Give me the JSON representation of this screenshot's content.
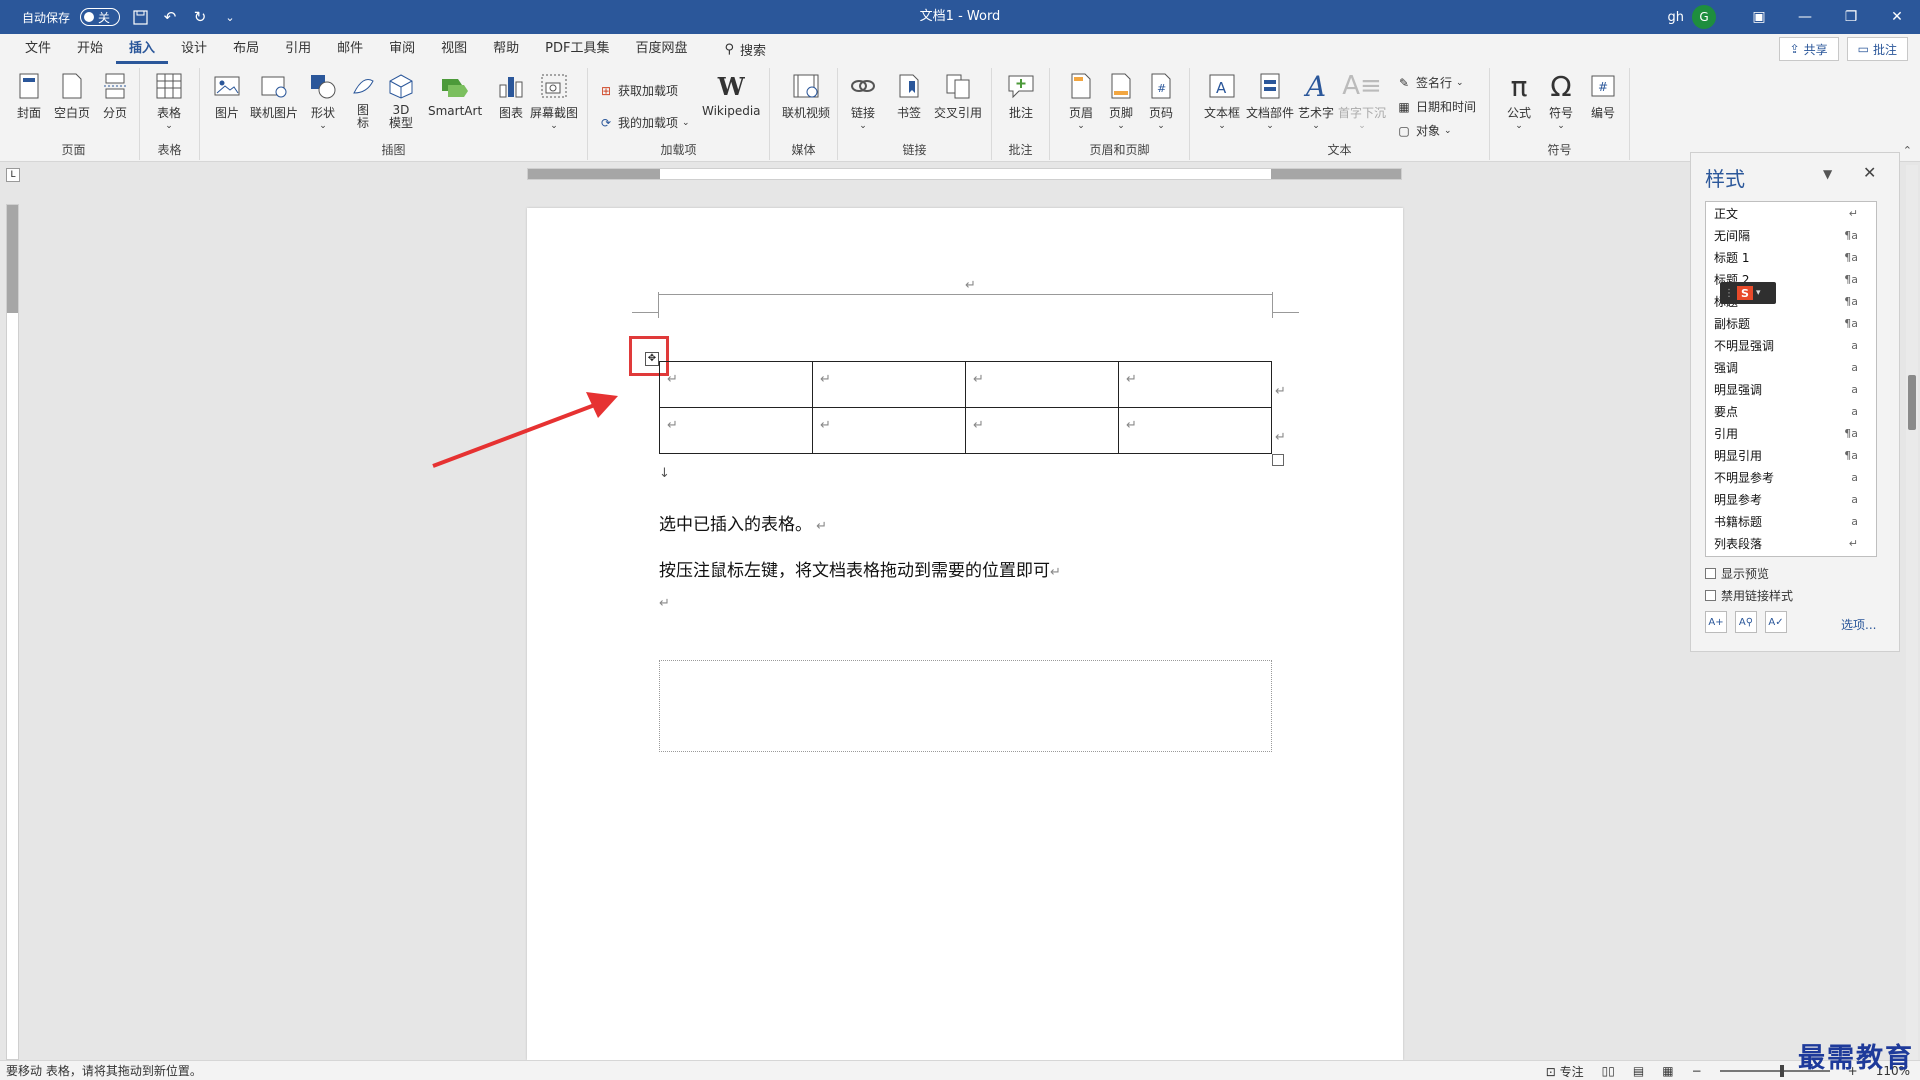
{
  "titlebar": {
    "autosave_label": "自动保存",
    "autosave_state": "关",
    "title": "文档1  -  Word",
    "user": "gh",
    "avatar_letter": "G"
  },
  "tabs": [
    "文件",
    "开始",
    "插入",
    "设计",
    "布局",
    "引用",
    "邮件",
    "审阅",
    "视图",
    "帮助",
    "PDF工具集",
    "百度网盘"
  ],
  "active_tab": "插入",
  "search_label": "搜索",
  "share_label": "共享",
  "comments_label": "批注",
  "ribbon": {
    "groups": {
      "pages": "页面",
      "tables": "表格",
      "illustrations": "插图",
      "addins": "加载项",
      "media": "媒体",
      "links": "链接",
      "comments": "批注",
      "header_footer": "页眉和页脚",
      "text": "文本",
      "symbols": "符号"
    },
    "buttons": {
      "cover": "封面",
      "blank_page": "空白页",
      "page_break": "分页",
      "table": "表格",
      "picture": "图片",
      "online_picture": "联机图片",
      "shapes": "形状",
      "icons": "图\n标",
      "model3d": "3D\n模型",
      "smartart": "SmartArt",
      "chart": "图表",
      "screenshot": "屏幕截图",
      "get_addins": "获取加载项",
      "my_addins": "我的加载项",
      "wikipedia": "Wikipedia",
      "online_video": "联机视频",
      "link": "链接",
      "bookmark": "书签",
      "cross_ref": "交叉引用",
      "comment": "批注",
      "header": "页眉",
      "footer": "页脚",
      "page_number": "页码",
      "textbox": "文本框",
      "quick_parts": "文档部件",
      "wordart": "艺术字",
      "dropcap": "首字下沉",
      "signature": "签名行",
      "datetime": "日期和时间",
      "object": "对象",
      "equation": "公式",
      "symbol": "符号",
      "number": "编号"
    }
  },
  "ruler_corner": "L",
  "document": {
    "para1": "选中已插入的表格。",
    "para2": "按压注鼠标左键，将文档表格拖动到需要的位置即可",
    "table_rows": 2,
    "table_cols": 4
  },
  "styles_pane": {
    "title": "样式",
    "items": [
      {
        "name": "正文",
        "mark": "↵"
      },
      {
        "name": "无间隔",
        "mark": "¶a"
      },
      {
        "name": "标题 1",
        "mark": "¶a"
      },
      {
        "name": "标题 2",
        "mark": "¶a"
      },
      {
        "name": "标题",
        "mark": "¶a"
      },
      {
        "name": "副标题",
        "mark": "¶a"
      },
      {
        "name": "不明显强调",
        "mark": "a"
      },
      {
        "name": "强调",
        "mark": "a"
      },
      {
        "name": "明显强调",
        "mark": "a"
      },
      {
        "name": "要点",
        "mark": "a"
      },
      {
        "name": "引用",
        "mark": "¶a"
      },
      {
        "name": "明显引用",
        "mark": "¶a"
      },
      {
        "name": "不明显参考",
        "mark": "a"
      },
      {
        "name": "明显参考",
        "mark": "a"
      },
      {
        "name": "书籍标题",
        "mark": "a"
      },
      {
        "name": "列表段落",
        "mark": "↵"
      }
    ],
    "show_preview": "显示预览",
    "disable_linked": "禁用链接样式",
    "options": "选项..."
  },
  "status": {
    "message": "要移动 表格，请将其拖动到新位置。",
    "focus": "专注",
    "zoom": "110%"
  },
  "watermark": "最需教育",
  "colors": {
    "accent": "#2b579a",
    "highlight": "#e03a3a"
  }
}
